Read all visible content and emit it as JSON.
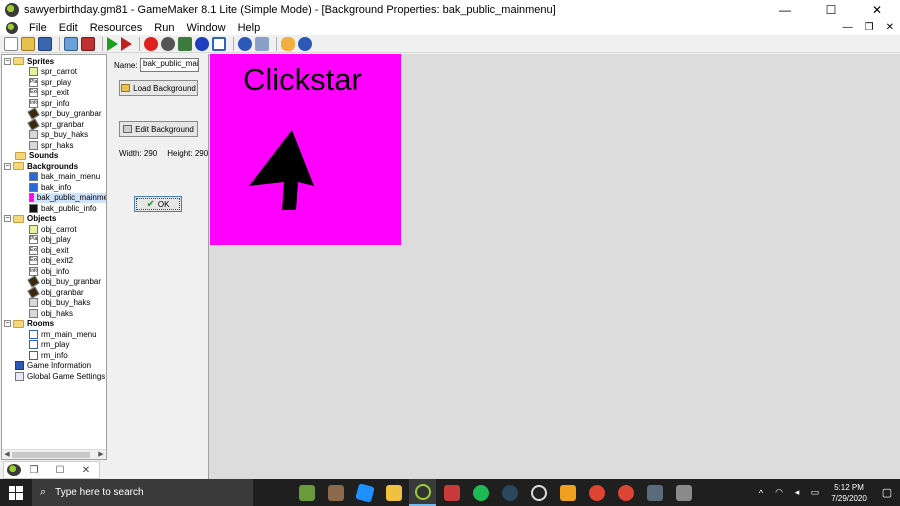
{
  "window": {
    "title": "sawyerbirthday.gm81 - GameMaker 8.1 Lite (Simple Mode) - [Background Properties: bak_public_mainmenu]",
    "controls": {
      "minimize": "—",
      "maximize": "☐",
      "close": "✕"
    }
  },
  "menu": {
    "items": [
      "File",
      "Edit",
      "Resources",
      "Run",
      "Window",
      "Help"
    ],
    "mdi_controls": {
      "minimize": "—",
      "restore": "❐",
      "close": "✕"
    }
  },
  "tree": {
    "groups": [
      {
        "label": "Sprites",
        "items": [
          "spr_carrot",
          "spr_play",
          "spr_exit",
          "spr_info",
          "spr_buy_granbar",
          "spr_granbar",
          "sp_buy_haks",
          "spr_haks"
        ]
      },
      {
        "label": "Sounds",
        "items": []
      },
      {
        "label": "Backgrounds",
        "items": [
          "bak_main_menu",
          "bak_info",
          "bak_public_mainme",
          "bak_public_info"
        ]
      },
      {
        "label": "Objects",
        "items": [
          "obj_carrot",
          "obj_play",
          "obj_exit",
          "obj_exit2",
          "obj_info",
          "obj_buy_granbar",
          "obj_granbar",
          "obj_buy_haks",
          "obj_haks"
        ]
      },
      {
        "label": "Rooms",
        "items": [
          "rm_main_menu",
          "rm_play",
          "rm_info"
        ]
      }
    ],
    "extras": [
      "Game Information",
      "Global Game Settings"
    ],
    "icon_texts": {
      "play": "Play",
      "exit": "Exit",
      "info": "Info"
    }
  },
  "props": {
    "name_label": "Name:",
    "name_value": "bak_public_mainr",
    "load_button": "Load Background",
    "edit_button": "Edit Background",
    "width_text": "Width: 290",
    "height_text": "Height: 290",
    "ok_button": "OK"
  },
  "canvas": {
    "text": "Clickstar",
    "background_color": "#ff00ff"
  },
  "minimized": {
    "restore": "❐",
    "maximize": "☐",
    "close": "✕"
  },
  "taskbar": {
    "search_placeholder": "Type here to search",
    "time": "5:12 PM",
    "date": "7/29/2020",
    "tray_chevron": "^"
  }
}
